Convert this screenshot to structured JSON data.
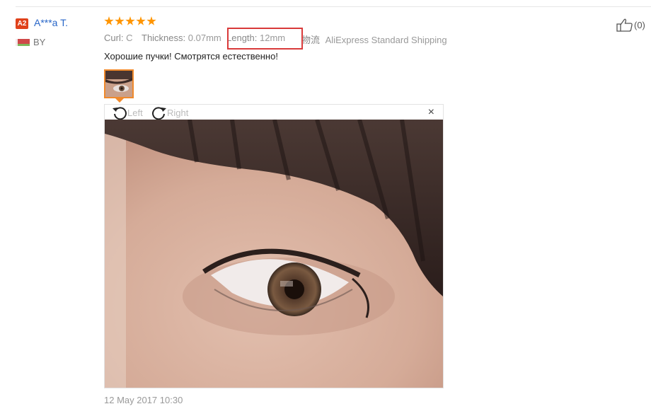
{
  "user": {
    "level": "A2",
    "name": "A***a T.",
    "country": "BY"
  },
  "review": {
    "rating": 5,
    "attributes": [
      {
        "key": "Curl:",
        "value": "C"
      },
      {
        "key": "Thickness:",
        "value": "0.07mm"
      },
      {
        "key": "Length:",
        "value": "12mm"
      }
    ],
    "shipping_label": "物流",
    "shipping_value": "AliExpress Standard Shipping",
    "text": "Хорошие пучки! Смотрятся естественно!",
    "date": "12 May 2017 10:30"
  },
  "viewer": {
    "rotate_left_label": "Left",
    "rotate_right_label": "Right",
    "close_label": "×"
  },
  "likes": {
    "count_label": "(0)"
  },
  "colors": {
    "accent_orange": "#f08a2c",
    "star": "#ff9500",
    "link_blue": "#2866c8",
    "highlight_red": "#d93a3a",
    "badge_red": "#e0421b"
  }
}
